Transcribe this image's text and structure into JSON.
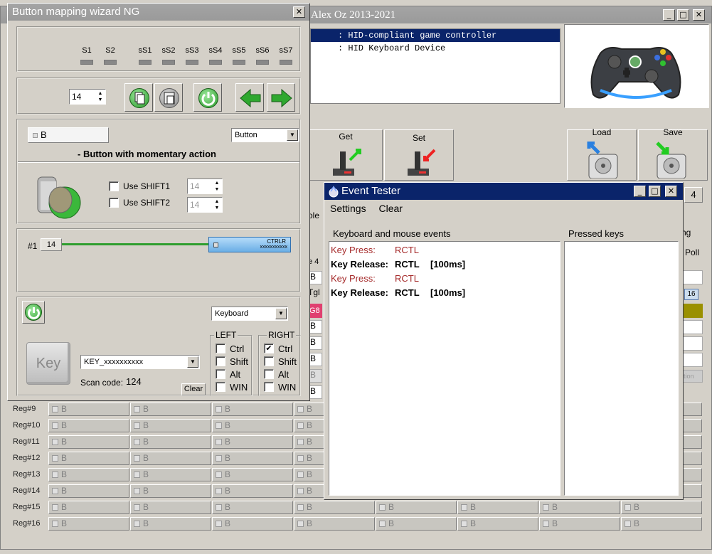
{
  "background_app": {
    "title": "Alex Oz 2013-2021",
    "devices": [
      ": HID-compliant game controller",
      ": HID Keyboard Device"
    ],
    "get_label": "Get",
    "set_label": "Set",
    "load_label": "Load",
    "save_label": "Save",
    "partial": {
      "page4": "4",
      "poll": "Poll",
      "ng": "ng",
      "ole": "ole",
      "e4": "e 4",
      "tgl": "Tgl",
      "g8": "G8",
      "n16": "16",
      "tion": "tion"
    },
    "cell_label": "B",
    "reg_rows": [
      "Reg#9",
      "Reg#10",
      "Reg#11",
      "Reg#12",
      "Reg#13",
      "Reg#14",
      "Reg#15",
      "Reg#16"
    ]
  },
  "wizard": {
    "title": "Button mapping wizard NG",
    "indicators": [
      "S1",
      "S2",
      "sS1",
      "sS2",
      "sS3",
      "sS4",
      "sS5",
      "sS6",
      "sS7"
    ],
    "spin_value": "14",
    "button_name": "B",
    "button_type": "Button",
    "description": "- Button with momentary action",
    "shift1_label": "Use SHIFT1",
    "shift2_label": "Use SHIFT2",
    "shift1_value": "14",
    "shift2_value": "14",
    "slot_label": "#1",
    "slot_value": "14",
    "slider_label": "CTRLR",
    "slider_value": "xxxxxxxxxxx",
    "output_type": "Keyboard",
    "key_icon_label": "Key",
    "key_combo": "KEY_xxxxxxxxxx",
    "scan_code_label": "Scan code:",
    "scan_code_value": "124",
    "clear_label": "Clear",
    "left_group": "LEFT",
    "right_group": "RIGHT",
    "modifiers": [
      "Ctrl",
      "Shift",
      "Alt",
      "WIN"
    ],
    "left_checked": [
      false,
      false,
      false,
      false
    ],
    "right_checked": [
      true,
      false,
      false,
      false
    ],
    "check_mark": "✔"
  },
  "tester": {
    "title": "Event Tester",
    "menu": [
      "Settings",
      "Clear"
    ],
    "events_header": "Keyboard and mouse events",
    "pressed_header": "Pressed keys",
    "events": [
      {
        "kind": "Key Press:",
        "key": "RCTL",
        "time": ""
      },
      {
        "kind": "Key Release:",
        "key": "RCTL",
        "time": "[100ms]"
      },
      {
        "kind": "Key Press:",
        "key": "RCTL",
        "time": ""
      },
      {
        "kind": "Key Release:",
        "key": "RCTL",
        "time": "[100ms]"
      }
    ]
  },
  "colors": {
    "active_title": "#0a246a",
    "inactive_title": "#a0a0a0",
    "press_text": "#a52a2a",
    "green_line": "#2e9e2e",
    "slider": "#7fb8e8"
  }
}
